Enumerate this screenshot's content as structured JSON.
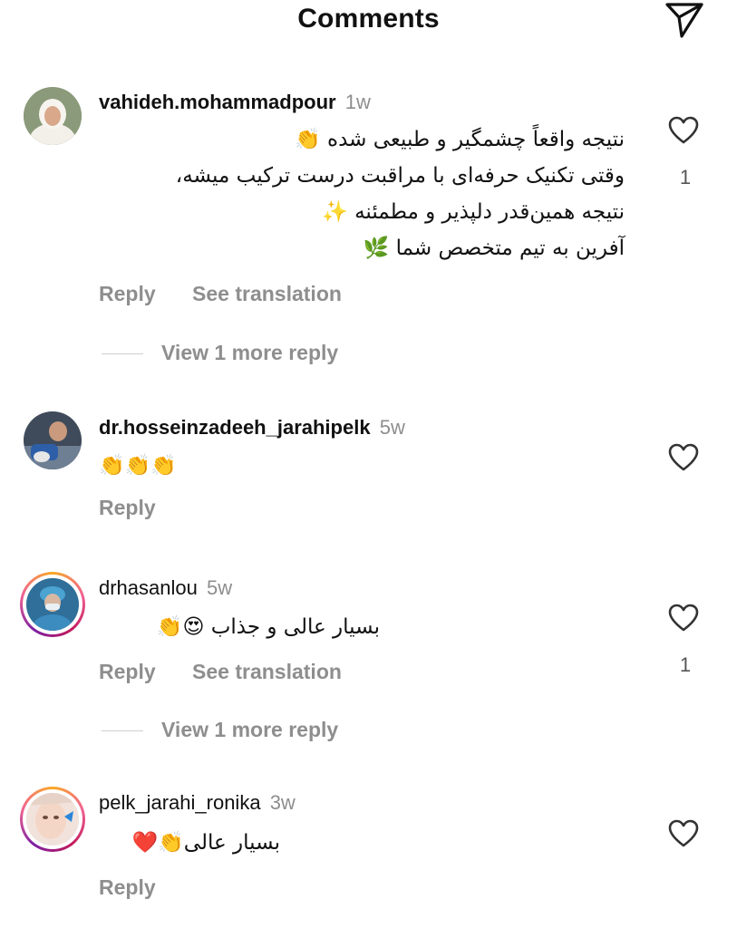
{
  "header": {
    "title": "Comments"
  },
  "comments": [
    {
      "username": "vahideh.mohammadpour",
      "time": "1w",
      "lines": [
        "نتیجه واقعاً چشمگیر و طبیعی شده 👏",
        "وقتی تکنیک حرفه‌ای با مراقبت درست ترکیب میشه،",
        "نتیجه همین‌قدر دلپذیر و مطمئنه ✨",
        "آفرین به تیم متخصص شما 🌿"
      ],
      "reply_label": "Reply",
      "translate_label": "See translation",
      "like_count": "1",
      "view_more": "View 1 more reply"
    },
    {
      "username": "dr.hosseinzadeeh_jarahipelk",
      "time": "5w",
      "lines": [
        "👏👏👏"
      ],
      "reply_label": "Reply"
    },
    {
      "username": "drhasanlou",
      "time": "5w",
      "lines": [
        "بسیار عالی و جذاب 😍👏"
      ],
      "reply_label": "Reply",
      "translate_label": "See translation",
      "like_count": "1",
      "view_more": "View 1 more reply"
    },
    {
      "username": "pelk_jarahi_ronika",
      "time": "3w",
      "lines": [
        "بسیار عالی👏❤️"
      ],
      "reply_label": "Reply"
    }
  ],
  "colors": {
    "secondary_text": "#8e8e8e",
    "primary_text": "#111111",
    "story_ring": "#e1306c"
  },
  "icons": {
    "send": "paper-plane-icon",
    "like": "heart-outline-icon"
  }
}
